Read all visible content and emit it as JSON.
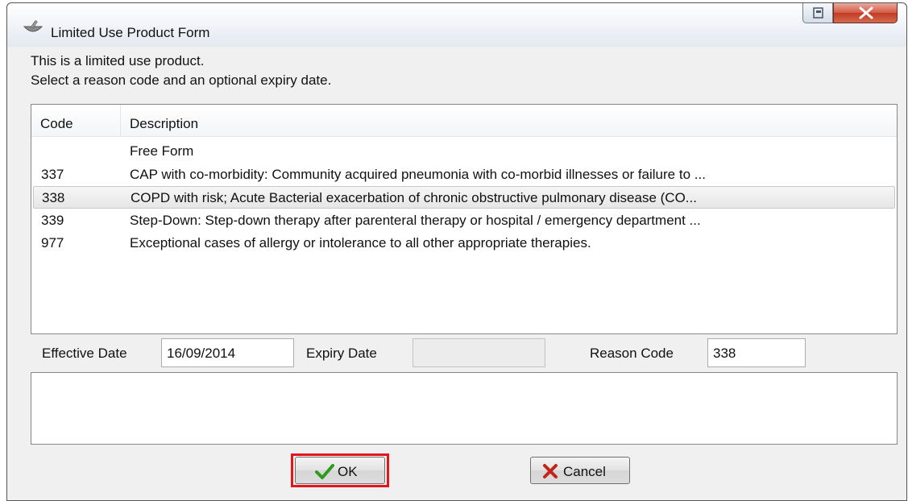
{
  "window": {
    "title": "Limited Use Product Form",
    "icon": "mortar-pestle-icon"
  },
  "intro": {
    "line1": "This is a limited use product.",
    "line2": "Select a reason code and an optional expiry date."
  },
  "list": {
    "columns": [
      "Code",
      "Description"
    ],
    "rows": [
      {
        "code": "",
        "description": "Free Form",
        "selected": false
      },
      {
        "code": "337",
        "description": "CAP with co-morbidity: Community acquired pneumonia with co-morbid illnesses or failure to ...",
        "selected": false
      },
      {
        "code": "338",
        "description": "COPD with risk; Acute Bacterial exacerbation of chronic obstructive pulmonary disease (CO...",
        "selected": true
      },
      {
        "code": "339",
        "description": "Step-Down: Step-down therapy after parenteral therapy or hospital / emergency department ...",
        "selected": false
      },
      {
        "code": "977",
        "description": "Exceptional cases of allergy or intolerance to all other appropriate therapies.",
        "selected": false
      }
    ]
  },
  "fields": {
    "effective_date_label": "Effective Date",
    "effective_date_value": "16/09/2014",
    "expiry_date_label": "Expiry Date",
    "expiry_date_value": "",
    "reason_code_label": "Reason Code",
    "reason_code_value": "338"
  },
  "buttons": {
    "ok_label": "OK",
    "cancel_label": "Cancel",
    "ok_icon": "checkmark-icon",
    "cancel_icon": "x-icon"
  },
  "colors": {
    "highlight": "#e3161c",
    "ok_check": "#2e9a1c",
    "cancel_x": "#c0241a"
  }
}
